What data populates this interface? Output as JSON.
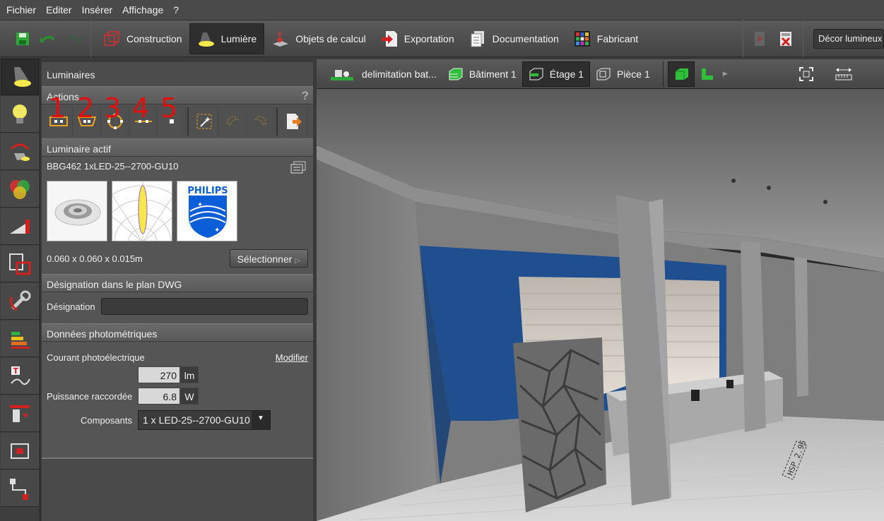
{
  "menu": [
    "Fichier",
    "Editer",
    "Insérer",
    "Affichage",
    "?"
  ],
  "toolbar": {
    "tabs": [
      {
        "label": "Construction",
        "icon": "cube-wireframe-icon"
      },
      {
        "label": "Lumière",
        "icon": "lamp-icon",
        "active": true
      },
      {
        "label": "Objets de calcul",
        "icon": "calc-objects-icon"
      },
      {
        "label": "Exportation",
        "icon": "export-icon"
      },
      {
        "label": "Documentation",
        "icon": "document-icon"
      },
      {
        "label": "Fabricant",
        "icon": "manufacturer-grid-icon"
      }
    ],
    "decor_label": "Décor lumineux"
  },
  "panel": {
    "title": "Luminaires",
    "actions_label": "Actions",
    "help": "?",
    "action_numbers": [
      "1",
      "2",
      "3",
      "4",
      "5"
    ],
    "active_luminaire_label": "Luminaire actif",
    "luminaire_name": "BBG462 1xLED-25--2700-GU10",
    "brand": "PHILIPS",
    "dimensions": "0.060 x 0.060 x 0.015m",
    "select_button": "Sélectionner",
    "dwg_section": "Désignation dans le plan DWG",
    "designation_label": "Désignation",
    "designation_value": "",
    "photometric_section": "Données photométriques",
    "flux_label": "Courant photoélectrique",
    "modify_link": "Modifier",
    "flux_value": "270",
    "flux_unit": "lm",
    "power_label": "Puissance raccordée",
    "power_value": "6.8",
    "power_unit": "W",
    "components_label": "Composants",
    "components_value": "1 x LED-25--2700-GU10"
  },
  "viewport": {
    "tabs": [
      {
        "label": "delimitation bat...",
        "icon": "terrain-icon"
      },
      {
        "label": "Bâtiment 1",
        "icon": "building-icon"
      },
      {
        "label": "Étage 1",
        "icon": "floor-icon",
        "active": true
      },
      {
        "label": "Pièce 1",
        "icon": "room-icon"
      }
    ],
    "floor_label": "HSP 2.95"
  },
  "colors": {
    "accent_green": "#2fbf3a",
    "accent_yellow": "#f4e84a",
    "number_red": "#e01010",
    "wall_blue": "#1f4f8f"
  }
}
